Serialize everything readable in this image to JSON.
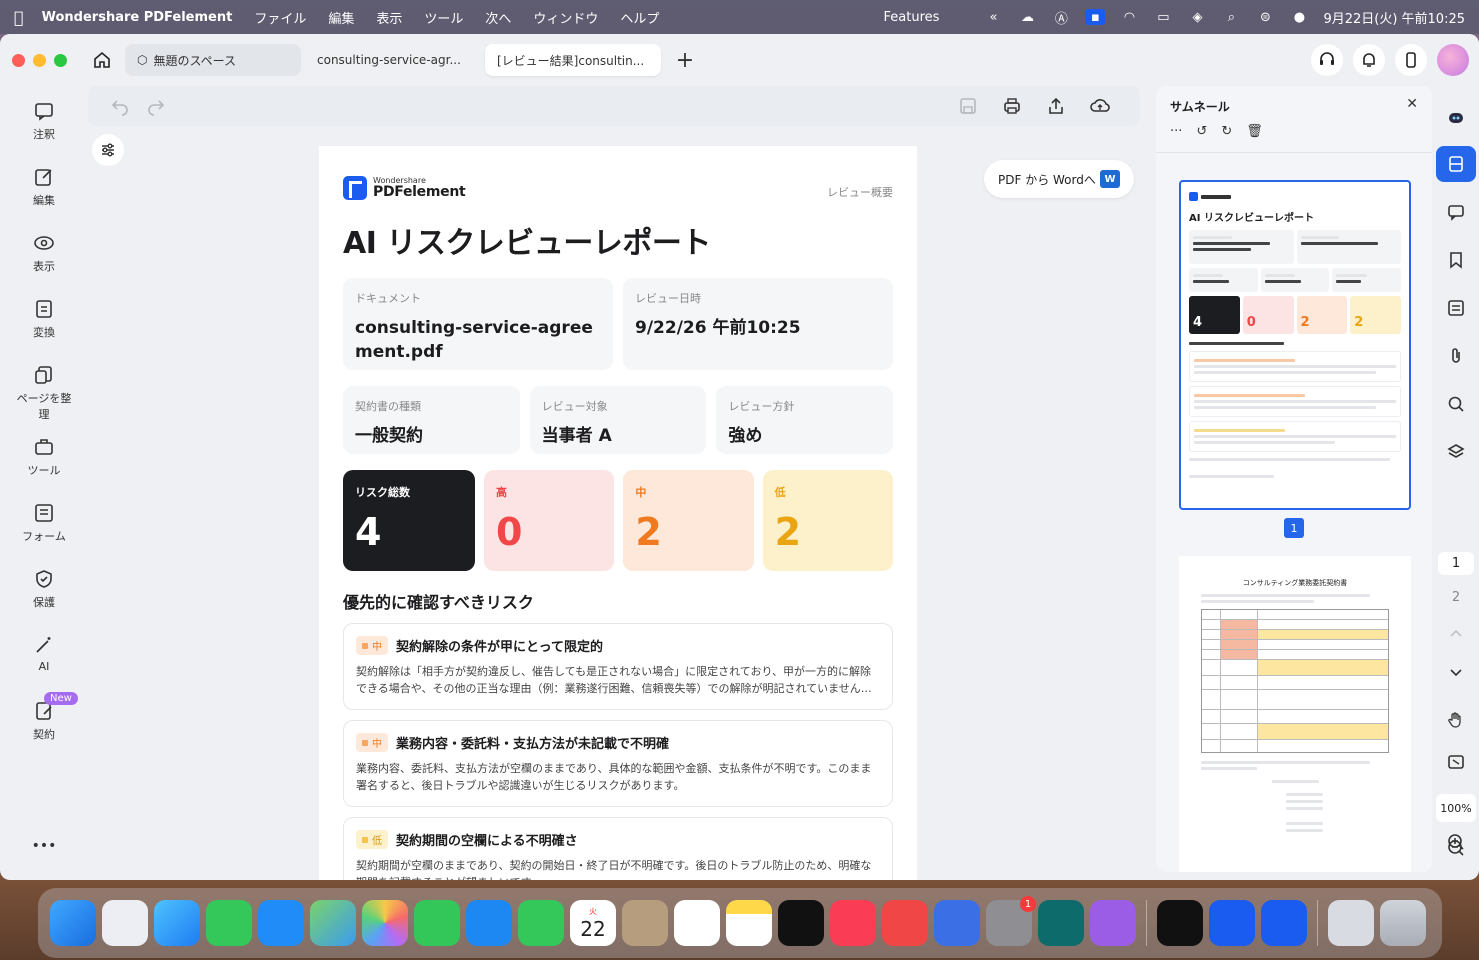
{
  "menubar": {
    "app_name": "Wondershare PDFelement",
    "menus": [
      "ファイル",
      "編集",
      "表示",
      "ツール",
      "次へ",
      "ウィンドウ",
      "ヘルプ"
    ],
    "features": "Features",
    "datetime": "9月22日(火) 午前10:25"
  },
  "tabs": {
    "space": "無題のスペース",
    "doc1": "consulting-service-agr...",
    "doc2": "[レビュー結果]consultin..."
  },
  "sidebar": {
    "items": [
      {
        "label": "注釈"
      },
      {
        "label": "編集"
      },
      {
        "label": "表示"
      },
      {
        "label": "変換"
      },
      {
        "label": "ページを整理"
      },
      {
        "label": "ツール"
      },
      {
        "label": "フォーム"
      },
      {
        "label": "保護"
      },
      {
        "label": "AI"
      },
      {
        "label": "契約"
      }
    ],
    "new_badge": "New",
    "more": "•••"
  },
  "pdf_to_word": "PDF から Wordへ",
  "report": {
    "brand_small": "Wondershare",
    "brand_big": "PDFelement",
    "summary_label": "レビュー概要",
    "title": "AI リスクレビューレポート",
    "document_label": "ドキュメント",
    "document_value": "consulting-service-agreement.pdf",
    "review_date_label": "レビュー日時",
    "review_date_value": "9/22/26 午前10:25",
    "contract_type_label": "契約書の種類",
    "contract_type_value": "一般契約",
    "target_label": "レビュー対象",
    "target_value": "当事者 A",
    "policy_label": "レビュー方針",
    "policy_value": "強め",
    "risk_total_label": "リスク総数",
    "risk_total": "4",
    "high_label": "高",
    "high_count": "0",
    "mid_label": "中",
    "mid_count": "2",
    "low_label": "低",
    "low_count": "2",
    "section_title": "優先的に確認すべきリスク",
    "risks": [
      {
        "level": "中",
        "title": "契約解除の条件が甲にとって限定的",
        "desc": "契約解除は「相手方が契約違反し、催告しても是正されない場合」に限定されており、甲が一方的に解除できる場合や、その他の正当な理由（例：業務遂行困難、信頼喪失等）での解除が明記されていません…"
      },
      {
        "level": "中",
        "title": "業務内容・委託料・支払方法が未記載で不明確",
        "desc": "業務内容、委託料、支払方法が空欄のままであり、具体的な範囲や金額、支払条件が不明です。このまま署名すると、後日トラブルや認識違いが生じるリスクがあります。"
      },
      {
        "level": "低",
        "title": "契約期間の空欄による不明確さ",
        "desc": "契約期間が空欄のままであり、契約の開始日・終了日が不明確です。後日のトラブル防止のため、明確な期間を記載することが望ましいです。"
      }
    ]
  },
  "thumbnails": {
    "title": "サムネール",
    "page1_number": "1",
    "page2_title": "コンサルティング業務委託契約書"
  },
  "rightrail": {
    "page_current": "1",
    "page_next": "2",
    "zoom": "100%"
  },
  "dock": {
    "calendar_day": "22",
    "calendar_month": "火",
    "settings_badge": "1"
  }
}
